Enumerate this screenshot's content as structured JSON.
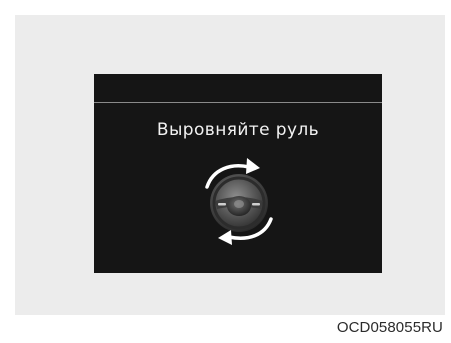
{
  "display": {
    "message": "Выровняйте руль"
  },
  "graphic": {
    "icon": "steering-wheel-align-icon",
    "arrow_top_icon": "arrow-clockwise-icon",
    "arrow_bottom_icon": "arrow-counterclockwise-icon"
  },
  "figure": {
    "code": "OCD058055RU"
  },
  "colors": {
    "panel_background": "#ececec",
    "screen_background": "#151515",
    "text": "#f2f2f2",
    "divider": "#8a8a8a"
  }
}
